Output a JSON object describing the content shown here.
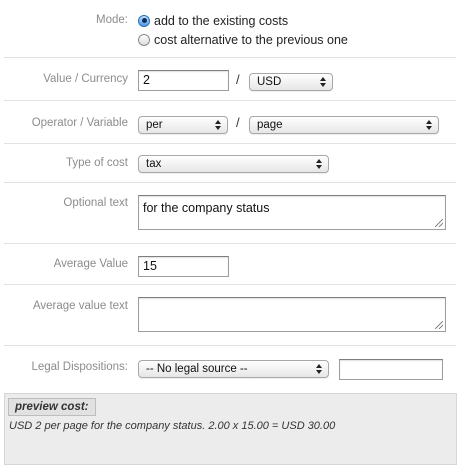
{
  "form": {
    "mode": {
      "label": "Mode:",
      "options": [
        {
          "label": "add to the existing costs",
          "selected": true
        },
        {
          "label": "cost alternative to the previous one",
          "selected": false
        }
      ]
    },
    "value_currency": {
      "label": "Value / Currency",
      "value": "2",
      "separator": "/",
      "currency": "USD"
    },
    "operator_variable": {
      "label": "Operator / Variable",
      "operator": "per",
      "separator": "/",
      "variable": "page"
    },
    "type_of_cost": {
      "label": "Type of cost",
      "value": "tax"
    },
    "optional_text": {
      "label": "Optional text",
      "value": "for the company status"
    },
    "average_value": {
      "label": "Average Value",
      "value": "15"
    },
    "average_value_text": {
      "label": "Average value text",
      "value": ""
    },
    "legal_dispositions": {
      "label": "Legal Dispositions:",
      "select_value": "-- No legal source --",
      "input_value": ""
    }
  },
  "preview": {
    "legend": "preview cost:",
    "text": "USD 2 per page for the company status. 2.00 x 15.00 = USD 30.00"
  }
}
